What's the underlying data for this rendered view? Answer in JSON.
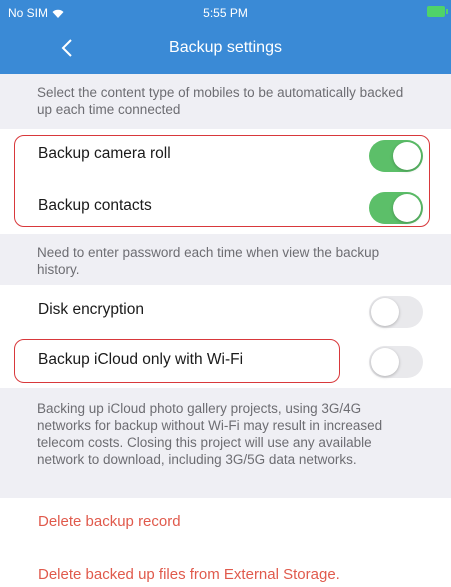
{
  "status_bar": {
    "carrier": "No SIM",
    "time": "5:55 PM"
  },
  "nav": {
    "title": "Backup settings"
  },
  "notes": {
    "auto_backup": "Select the content type of mobiles to be automatically backed up each time connected",
    "password": "Need to enter password each time when view the backup history.",
    "icloud": "Backing up iCloud photo gallery projects, using 3G/4G networks for backup without Wi-Fi may result in increased telecom costs. Closing this project will use any available network to download, including 3G/5G data networks."
  },
  "rows": {
    "camera_roll": {
      "label": "Backup camera roll",
      "on": true
    },
    "contacts": {
      "label": "Backup contacts",
      "on": true
    },
    "disk_encryption": {
      "label": "Disk encryption",
      "on": false
    },
    "icloud_wifi": {
      "label": "Backup iCloud only with Wi-Fi",
      "on": false
    }
  },
  "actions": {
    "delete_record": "Delete backup record",
    "delete_external": "Delete backed up files from External Storage."
  },
  "colors": {
    "accent": "#3a8ad6",
    "toggle_on": "#5cbf69",
    "destructive": "#e05a4c",
    "highlight": "#d8383b"
  }
}
